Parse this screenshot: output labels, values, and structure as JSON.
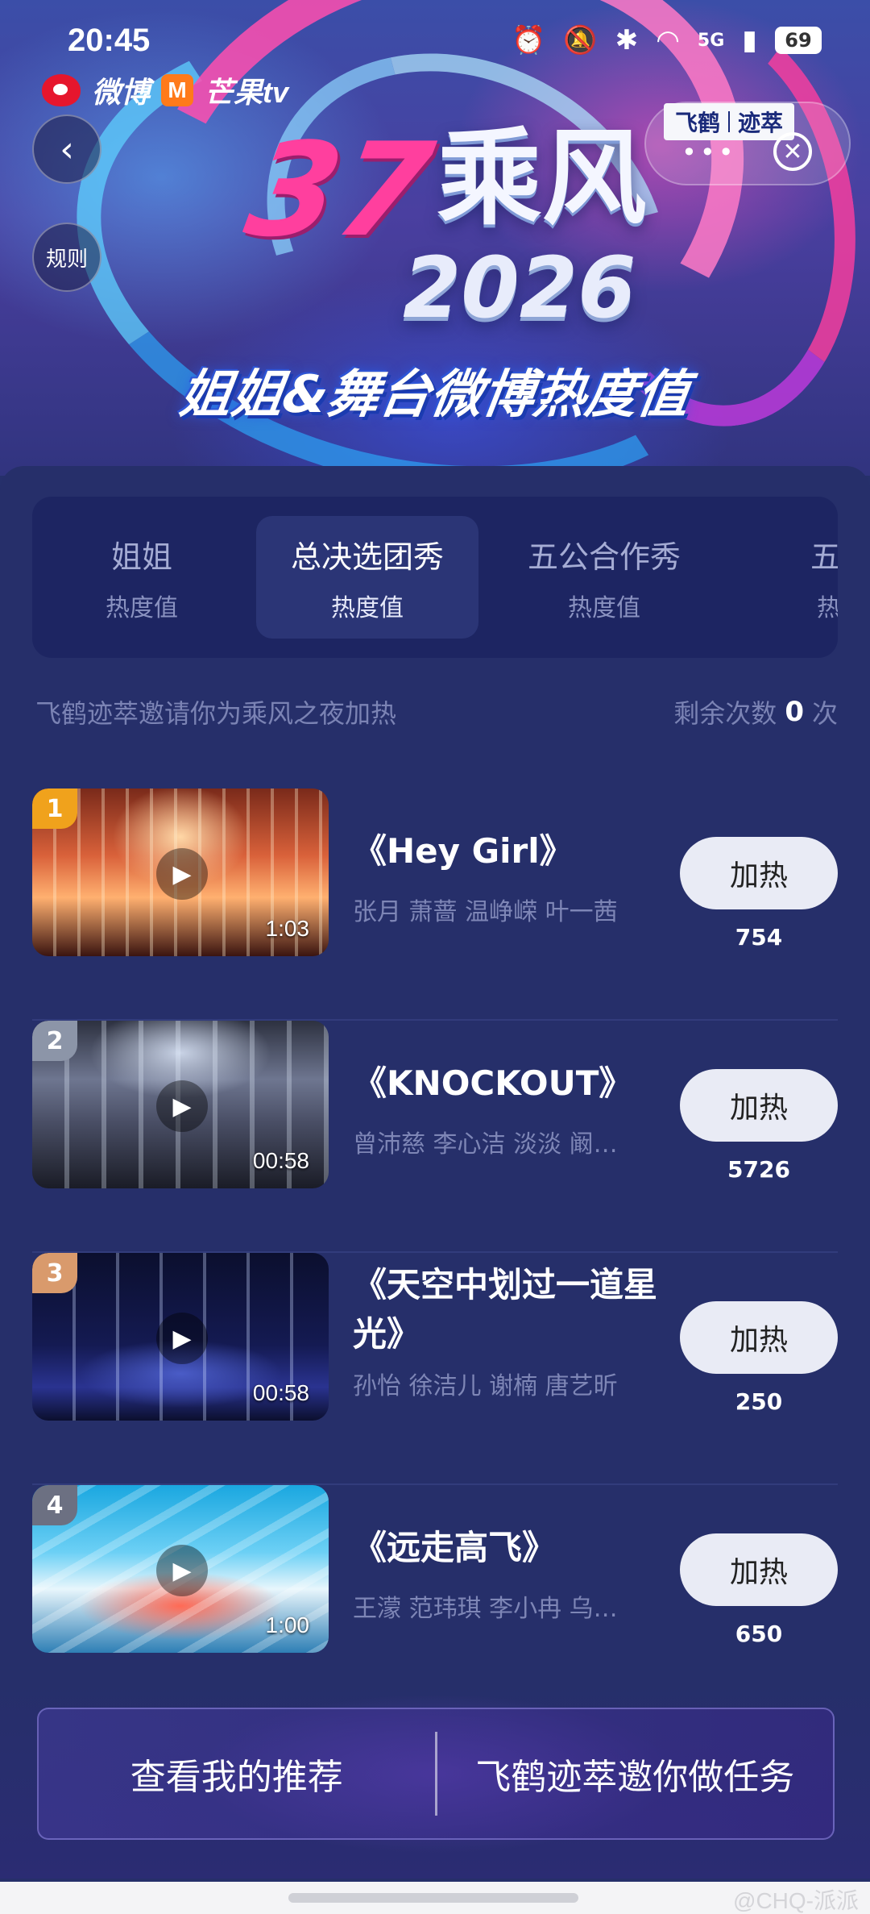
{
  "status_bar": {
    "time": "20:45",
    "network": "5G",
    "battery": "69"
  },
  "brand": {
    "weibo": "微博",
    "mango": "芒果tv"
  },
  "header": {
    "rules_label": "规则",
    "sponsor": [
      "飞鹤",
      "迹萃"
    ],
    "more": "•••",
    "close": "✕"
  },
  "hero": {
    "number": "37",
    "name": "乘风",
    "year": "2026",
    "subtitle": "姐姐&舞台微博热度值"
  },
  "tabs": [
    {
      "label": "姐姐",
      "sub": "热度值",
      "active": false
    },
    {
      "label": "总决选团秀",
      "sub": "热度值",
      "active": true
    },
    {
      "label": "五公合作秀",
      "sub": "热度值",
      "active": false
    },
    {
      "label": "五公",
      "sub": "热度",
      "active": false
    }
  ],
  "invite": {
    "text": "飞鹤迹萃邀请你为乘风之夜加热",
    "remain_label": "剩余次数",
    "remain_count": "0",
    "remain_unit": "次"
  },
  "items": [
    {
      "rank": "1",
      "rank_color": "#f0a21c",
      "title": "《Hey Girl》",
      "artists": "张月 萧蔷 温峥嵘 叶一茜",
      "duration": "1:03",
      "button": "加热",
      "count": "754"
    },
    {
      "rank": "2",
      "rank_color": "#8c95a8",
      "title": "《KNOCKOUT》",
      "artists": "曾沛慈 李心洁 淡淡 阚清子",
      "duration": "00:58",
      "button": "加热",
      "count": "5726"
    },
    {
      "rank": "3",
      "rank_color": "#d99a6c",
      "title": "《天空中划过一道星光》",
      "artists": "孙怡 徐洁儿 谢楠 唐艺昕",
      "duration": "00:58",
      "button": "加热",
      "count": "250"
    },
    {
      "rank": "4",
      "rank_color": "#6c7082",
      "title": "《远走高飞》",
      "artists": "王濛 范玮琪 李小冉 乌兰图雅",
      "duration": "1:00",
      "button": "加热",
      "count": "650"
    }
  ],
  "bottom": {
    "left": "查看我的推荐",
    "right": "飞鹤迹萃邀你做任务"
  },
  "watermark": "@CHQ-派派"
}
